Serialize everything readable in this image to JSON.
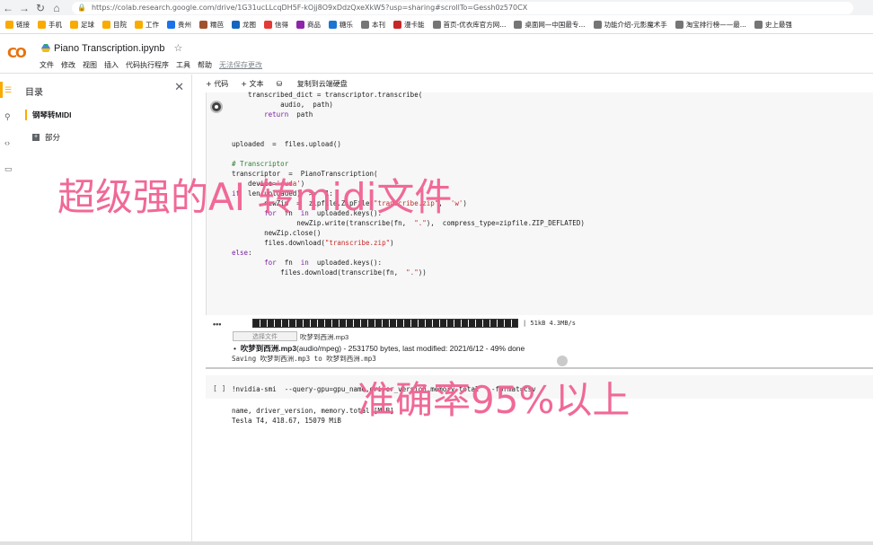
{
  "browser": {
    "url": "https://colab.research.google.com/drive/1G31ucLLcqDH5F-kOjj8O9xDdzQxeXkW5?usp=sharing#scrollTo=Gessh0z570CX",
    "bookmarks": [
      "链接",
      "手机",
      "足球",
      "目院",
      "工作",
      "贵州",
      "糯芭",
      "龙图",
      "信得",
      "商品",
      "糖乐",
      "本刊",
      "漫卡能",
      "首页-优衣库官方网...",
      "桌面网—中国最专...",
      "功能介绍-元影魔术手",
      "淘宝排行榜——最...",
      "史上最强"
    ]
  },
  "colab": {
    "logo": "CO",
    "notebook_title": "Piano Transcription.ipynb",
    "menu": [
      "文件",
      "修改",
      "视图",
      "插入",
      "代码执行程序",
      "工具",
      "帮助"
    ],
    "unsaved": "无法保存更改"
  },
  "sidebar": {
    "title": "目录",
    "items": [
      {
        "label": "钢琴转MIDI"
      },
      {
        "label": "部分"
      }
    ]
  },
  "toolbar": {
    "add_code": "+ 代码",
    "add_text": "+ 文本",
    "copy_drive": "复制到云端硬盘"
  },
  "code_cell": {
    "lines": [
      "    transcribed_dict = transcriptor.transcribe(",
      "            audio,  path)",
      "        return  path",
      "",
      "",
      "uploaded  =  files.upload()",
      "",
      "# Transcriptor",
      "transcriptor  =  PianoTranscription(",
      "    device='cuda')",
      "if  len(uploaded)  >=  1:",
      "        newZip  =  zipfile.ZipFile(\"transcribe.zip\",  'w')",
      "        for  fn  in  uploaded.keys():",
      "                newZip.write(transcribe(fn,  \".\"),  compress_type=zipfile.ZIP_DEFLATED)",
      "        newZip.close()",
      "        files.download(\"transcribe.zip\")",
      "else:",
      "        for  fn  in  uploaded.keys():",
      "            files.download(transcribe(fn,  \".\"))"
    ]
  },
  "output": {
    "progress_text": "| 51kB 4.3MB/s",
    "choose_button": "选择文件",
    "chosen_file": "吹梦到西洲.mp3",
    "file_name": "吹梦到西洲.mp3",
    "file_detail": "(audio/mpeg) - 2531750 bytes, last modified: 2021/6/12 - 49% done",
    "saving": "Saving 吹梦到西洲.mp3 to 吹梦到西洲.mp3"
  },
  "cell2": {
    "bracket": "[ ]",
    "command": "!nvidia-smi  --query-gpu=gpu_name,driver_version,memory.total  --format=csv",
    "output_line1": "name, driver_version, memory.total [MiB]",
    "output_line2": "Tesla T4, 418.67, 15079 MiB"
  },
  "overlay": {
    "caption1": "超级强的AI 转midi文件",
    "caption2": "准确率95%以上"
  }
}
